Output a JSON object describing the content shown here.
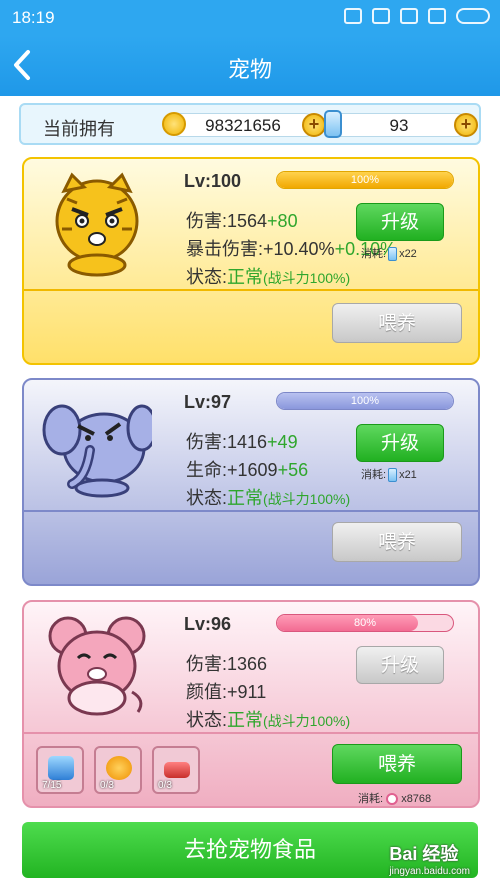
{
  "statusbar": {
    "time": "18:19"
  },
  "header": {
    "title": "宠物"
  },
  "owned": {
    "label": "当前拥有",
    "coins": "98321656",
    "bottles": "93"
  },
  "pets": [
    {
      "level": "Lv:100",
      "progress": 1.0,
      "progress_text": "100%",
      "line1_label": "伤害:1564",
      "line1_bonus": "+80",
      "line2_label": "暴击伤害:+10.40%",
      "line2_bonus": "+0.10%",
      "status_label": "状态:",
      "status_value": "正常",
      "status_detail": "(战斗力100%)",
      "upgrade_label": "升级",
      "cost_label": "消耗:",
      "cost_amount": "x22",
      "feed_label": "喂养",
      "color": "#f6c51c"
    },
    {
      "level": "Lv:97",
      "progress": 1.0,
      "progress_text": "100%",
      "line1_label": "伤害:1416",
      "line1_bonus": "+49",
      "line2_label": "生命:+1609",
      "line2_bonus": "+56",
      "status_label": "状态:",
      "status_value": "正常",
      "status_detail": "(战斗力100%)",
      "upgrade_label": "升级",
      "cost_label": "消耗:",
      "cost_amount": "x21",
      "feed_label": "喂养",
      "color": "#8f9bd6"
    },
    {
      "level": "Lv:96",
      "progress": 0.8,
      "progress_text": "80%",
      "line1_label": "伤害:1366",
      "line1_bonus": "",
      "line2_label": "颜值:+911",
      "line2_bonus": "",
      "status_label": "状态:",
      "status_value": "正常",
      "status_detail": "(战斗力100%)",
      "upgrade_label": "升级",
      "feed_label": "喂养",
      "feed_cost_label": "消耗:",
      "feed_cost_amount": "x8768",
      "items": [
        {
          "icon": "blue-gem-food-icon",
          "count": "7/15"
        },
        {
          "icon": "orange-fish-food-icon",
          "count": "0/3"
        },
        {
          "icon": "meat-food-icon",
          "count": "0/3"
        }
      ],
      "color": "#ee93ad"
    }
  ],
  "grab_food_label": "去抢宠物食品",
  "watermark": {
    "brand": "Bai 经验",
    "site": "jingyan.baidu.com"
  }
}
